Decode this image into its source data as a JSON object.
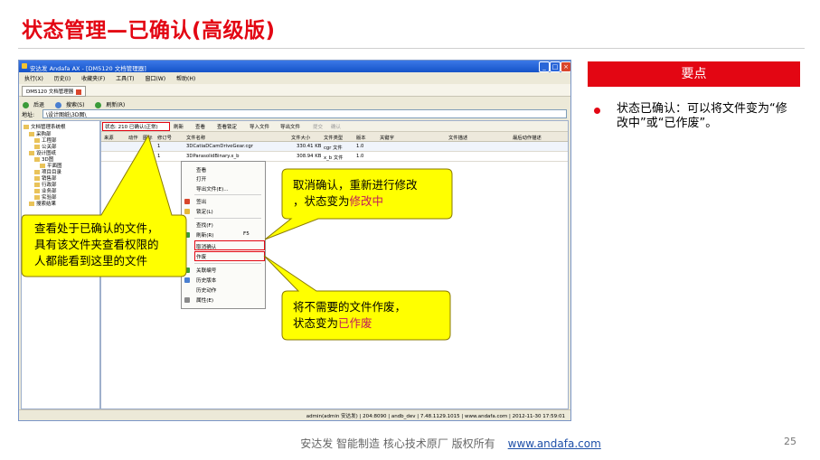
{
  "slide": {
    "title": "状态管理—已确认(高级版)",
    "page_number": "25"
  },
  "app": {
    "window_title": "安达发 Andafa AX - [DM5120 文档管理器]",
    "menu": [
      "执行(X)",
      "历史(I)",
      "收藏夹(F)",
      "工具(T)",
      "窗口(W)",
      "帮助(H)"
    ],
    "tab_label": "DM5120 文档管理器",
    "toolbar": [
      "后退",
      "搜索(S)",
      "刷新(R)"
    ],
    "address_label": "地址:",
    "address_value": "\\设计图纸\\3D图\\",
    "tree": [
      "文档管理系统根",
      "采购部",
      "工程部",
      "公关部",
      "设计图纸",
      "3D图",
      "平面图",
      "项目目录",
      "销售部",
      "行政部",
      "业务部",
      "实验部",
      "搜索结果"
    ],
    "status_filter": "状态: 210 已确认(正常)",
    "sub_toolbar": [
      "刷新",
      "查看",
      "查看锁定",
      "导入文件",
      "导出文件",
      "提交",
      "确认"
    ],
    "columns": [
      "来源",
      "动作",
      "图标",
      "修订号",
      "文件名称",
      "文件大小",
      "文件类型",
      "版本",
      "关键字",
      "文件描述",
      "最后动作描述"
    ],
    "rows": [
      {
        "rev": "1",
        "name": "3DCatiaDCamDriveGear.cgr",
        "size": "330.41 KB",
        "type": "cgr 文件",
        "ver": "1.0"
      },
      {
        "rev": "1",
        "name": "3DParasolidBinary.x_b",
        "size": "308.94 KB",
        "type": "x_b 文件",
        "ver": "1.0"
      }
    ],
    "context_menu": [
      "查看",
      "打开",
      "导出文件(E)...",
      "签出",
      "锁定(L)",
      "查找(F)",
      "刷新(R)",
      "F5",
      "取消确认",
      "作废",
      "关联编号",
      "历史版本",
      "历史动作",
      "属性(E)"
    ],
    "statusbar": "admin(admin 安达发) | 204:8090 | andb_dev | 7.48.1129.1015 | www.andafa.com | 2012-11-30 17:59:01"
  },
  "callouts": {
    "view": {
      "line1": "查看处于已确认的文件，",
      "line2": "具有该文件夹查看权限的",
      "line3": "人都能看到这里的文件"
    },
    "cancel": {
      "line1": "取消确认，重新进行修改",
      "line2_prefix": "，状态变为",
      "line2_highlight": "修改中"
    },
    "void": {
      "line1": "将不需要的文件作废，",
      "line2_prefix": "状态变为",
      "line2_highlight": "已作废"
    }
  },
  "key_points": {
    "header": "要点",
    "bullet": "状态已确认：可以将文件变为“修改中”或“已作废”。"
  },
  "footer": {
    "company": "安达发   智能制造 核心技术原厂   版权所有",
    "link": "www.andafa.com"
  },
  "colors": {
    "brand_red": "#e30613",
    "callout_fill": "#ffff00",
    "callout_stroke": "#8a7a00",
    "highlight_text": "#c2185b"
  }
}
